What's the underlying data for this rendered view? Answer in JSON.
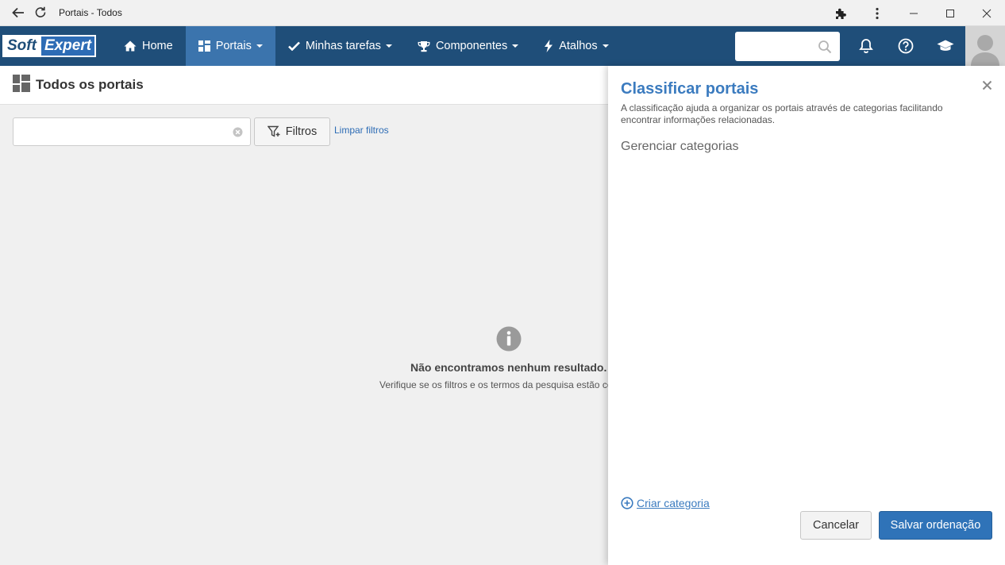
{
  "browser": {
    "title": "Portais - Todos"
  },
  "navbar": {
    "logo_soft": "Soft",
    "logo_expert": "Expert",
    "items": [
      {
        "label": "Home",
        "icon": "home-icon"
      },
      {
        "label": "Portais",
        "icon": "portals-icon",
        "active": true
      },
      {
        "label": "Minhas tarefas",
        "icon": "check-icon"
      },
      {
        "label": "Componentes",
        "icon": "trophy-icon"
      },
      {
        "label": "Atalhos",
        "icon": "bolt-icon"
      }
    ],
    "search_value": ""
  },
  "page": {
    "title": "Todos os portais"
  },
  "filters": {
    "search_value": "",
    "filter_button": "Filtros",
    "clear_link": "Limpar filtros"
  },
  "empty_state": {
    "message": "Não encontramos nenhum resultado.",
    "hint": "Verifique se os filtros e os termos da pesquisa estão co"
  },
  "panel": {
    "title": "Classificar portais",
    "description": "A classificação ajuda a organizar os portais através de categorias facilitando encontrar informações relacionadas.",
    "manage_label": "Gerenciar categorias",
    "create_link": "Criar categoria",
    "cancel_button": "Cancelar",
    "save_button": "Salvar ordenação"
  },
  "colors": {
    "navbar": "#1f4e79",
    "nav_active": "#3b74ad",
    "accent": "#3b7bbf",
    "primary_button": "#2f73b8"
  }
}
